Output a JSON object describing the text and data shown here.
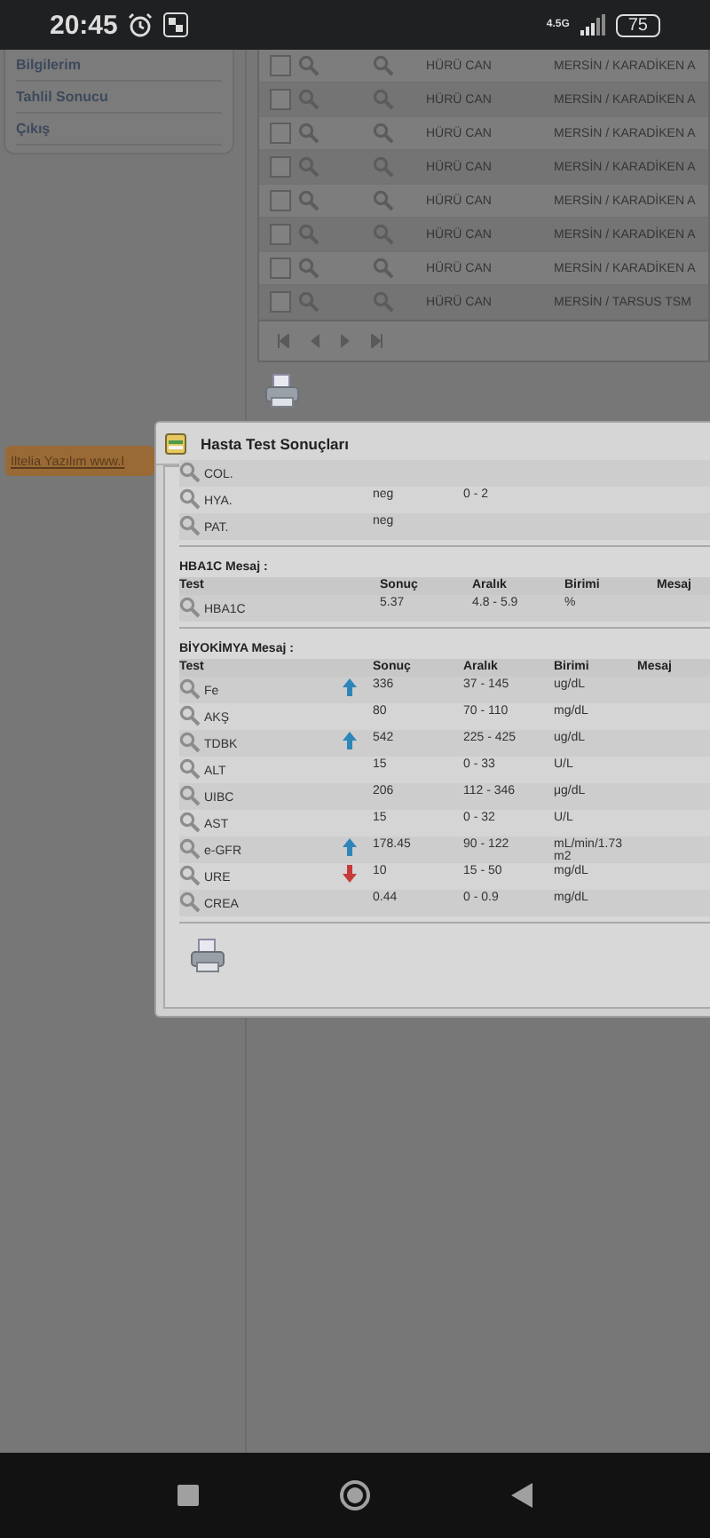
{
  "status_bar": {
    "time": "20:45",
    "network": "4.5G",
    "battery": "75"
  },
  "sidebar": {
    "items": [
      {
        "label": "Bilgilerim"
      },
      {
        "label": "Tahlil Sonucu"
      },
      {
        "label": "Çıkış"
      }
    ]
  },
  "records": {
    "rows": [
      {
        "checked": false,
        "name": "HÜRÜ CAN",
        "place": "MERSİN / KARADİKEN A"
      },
      {
        "checked": false,
        "name": "HÜRÜ CAN",
        "place": "MERSİN / KARADİKEN A"
      },
      {
        "checked": false,
        "name": "HÜRÜ CAN",
        "place": "MERSİN / KARADİKEN A"
      },
      {
        "checked": false,
        "name": "HÜRÜ CAN",
        "place": "MERSİN / KARADİKEN A"
      },
      {
        "checked": false,
        "name": "HÜRÜ CAN",
        "place": "MERSİN / KARADİKEN A"
      },
      {
        "checked": false,
        "name": "HÜRÜ CAN",
        "place": "MERSİN / KARADİKEN A"
      },
      {
        "checked": false,
        "name": "HÜRÜ CAN",
        "place": "MERSİN / KARADİKEN A"
      },
      {
        "checked": false,
        "name": "HÜRÜ CAN",
        "place": "MERSİN / TARSUS TSM"
      }
    ]
  },
  "footer_tag": "Iltelia Yazılım www.I",
  "dialog": {
    "title": "Hasta Test Sonuçları",
    "sections": [
      {
        "rows": [
          {
            "test": "COL.",
            "result": "",
            "range": "",
            "unit": ""
          },
          {
            "test": "HYA.",
            "result": "neg",
            "range": "0 - 2",
            "unit": ""
          },
          {
            "test": "PAT.",
            "result": "neg",
            "range": "",
            "unit": ""
          }
        ]
      },
      {
        "title": "HBA1C Mesaj :",
        "columns": [
          "Test",
          "Sonuç",
          "Aralık",
          "Birimi",
          "Mesaj"
        ],
        "rows": [
          {
            "test": "HBA1C",
            "result": "5.37",
            "range": "4.8 - 5.9",
            "unit": "%"
          }
        ]
      },
      {
        "title": "BİYOKİMYA Mesaj :",
        "columns": [
          "Test",
          "Sonuç",
          "Aralık",
          "Birimi",
          "Mesaj"
        ],
        "rows": [
          {
            "test": "Fe",
            "result": "336",
            "range": "37 - 145",
            "unit": "ug/dL",
            "high": true,
            "low": false
          },
          {
            "test": "AKŞ",
            "result": "80",
            "range": "70 - 110",
            "unit": "mg/dL",
            "high": false,
            "low": false
          },
          {
            "test": "TDBK",
            "result": "542",
            "range": "225 - 425",
            "unit": "ug/dL",
            "high": true,
            "low": false
          },
          {
            "test": "ALT",
            "result": "15",
            "range": "0 - 33",
            "unit": "U/L",
            "high": false,
            "low": false
          },
          {
            "test": "UIBC",
            "result": "206",
            "range": "112 - 346",
            "unit": "μg/dL",
            "high": false,
            "low": false
          },
          {
            "test": "AST",
            "result": "15",
            "range": "0 - 32",
            "unit": "U/L",
            "high": false,
            "low": false
          },
          {
            "test": "e-GFR",
            "result": "178.45",
            "range": "90 - 122",
            "unit": "mL/min/1.73 m2",
            "high": true,
            "low": false
          },
          {
            "test": "URE",
            "result": "10",
            "range": "15 - 50",
            "unit": "mg/dL",
            "high": false,
            "low": true
          },
          {
            "test": "CREA",
            "result": "0.44",
            "range": "0 - 0.9",
            "unit": "mg/dL",
            "high": false,
            "low": false
          }
        ]
      }
    ]
  }
}
